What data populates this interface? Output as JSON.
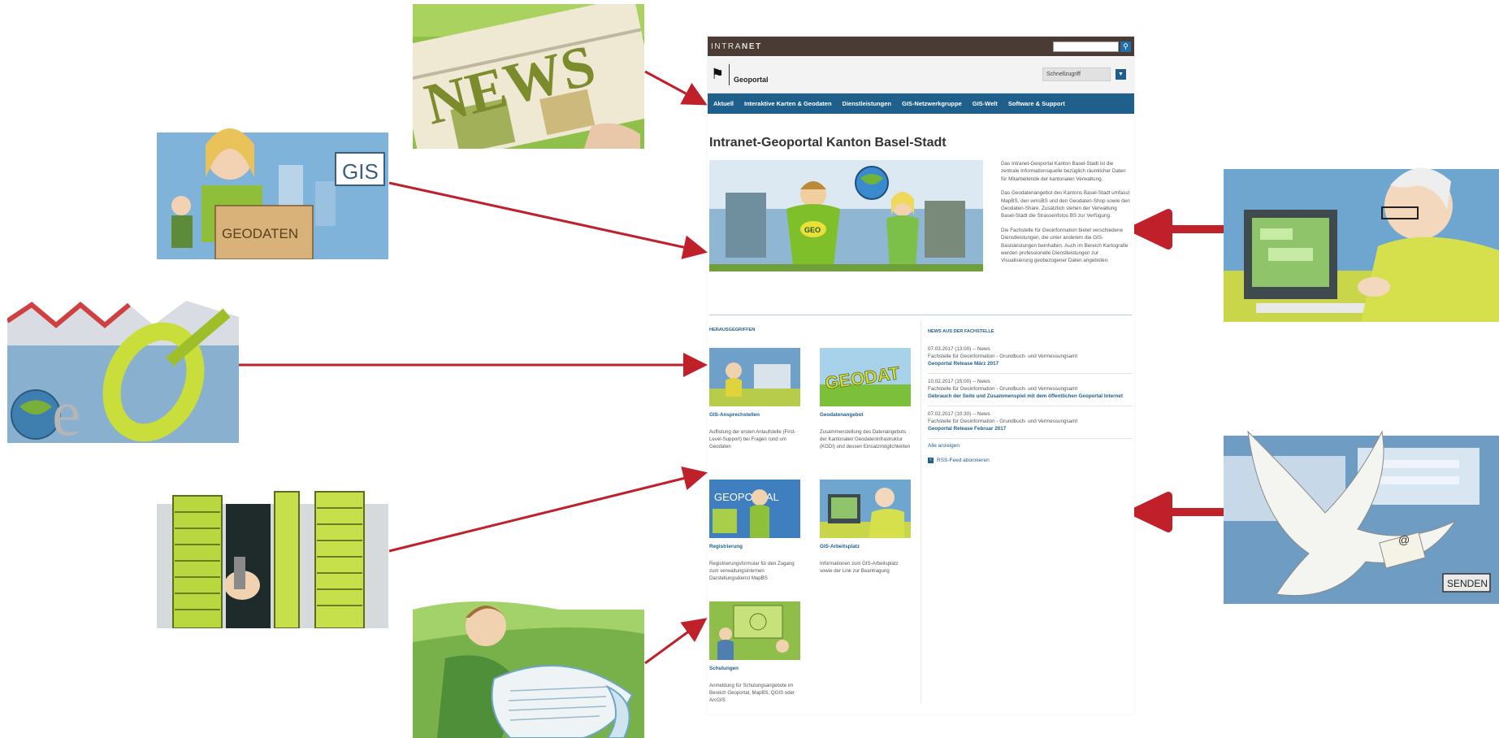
{
  "topbar": {
    "brand_light": "INTRA",
    "brand_bold": "NET",
    "search_placeholder": "",
    "search_icon": "search-icon"
  },
  "header": {
    "site_name": "Geoportal",
    "quick_access": "Schnellzugriff",
    "logo_icon": "basel-staff-icon"
  },
  "nav": [
    "Aktuell",
    "Interaktive Karten & Geodaten",
    "Dienstleistungen",
    "GIS-Netzwerkgruppe",
    "GIS-Welt",
    "Software & Support"
  ],
  "main": {
    "title": "Intranet-Geoportal Kanton Basel-Stadt",
    "intro": [
      "Das Intranet-Geoportal Kanton Basel-Stadt ist die zentrale Informationsquelle bezüglich räumlicher Daten für Mitarbeitende der kantonalen Verwaltung.",
      "Das Geodatenangebot des Kantons Basel-Stadt umfasst MapBS, den wmsBS und den Geodaten-Shop sowie den Geodaten-Share. Zusätzlich stehen der Verwaltung Basel-Stadt die Strassenfotos BS zur Verfügung.",
      "Die Fachstelle für Geoinformation bietet verschiedene Dienstleistungen, die unter anderem die GIS-Basisleistungen beinhalten. Auch im Bereich Kartografie werden professionelle Dienstleistungen zur Visualisierung geobezogener Daten angeboten."
    ]
  },
  "featured": {
    "heading": "HERAUSGEGRIFFEN",
    "cards": [
      {
        "title": "GIS-Ansprechstellen",
        "desc": "Auflistung der ersten Anlaufstelle (First-Level-Support) bei Fragen rund um Geodaten"
      },
      {
        "title": "Geodatenangebot",
        "desc": "Zusammenstellung des Datenangebots der Kantonalen Geodateninfrastruktur (KGDI) und dessen Einsatzmöglichkeiten"
      },
      {
        "title": "Registrierung",
        "desc": "Registrierungsformular für den Zugang zum verwaltungsinternen Darstellungsdienst MapBS"
      },
      {
        "title": "GIS-Arbeitsplatz",
        "desc": "Informationen zum GIS-Arbeitsplatz sowie der Link zur Beantragung"
      },
      {
        "title": "Schulungen",
        "desc": "Anmeldung für Schulungsangebote im Bereich Geoportal, MapBS, QGIS oder ArcGIS"
      }
    ]
  },
  "news": {
    "heading": "NEWS AUS DER FACHSTELLE",
    "items": [
      {
        "meta": "07.03.2017 (13:00) -- News",
        "source": "Fachstelle für Geoinformation - Grundbuch- und Vermessungsamt",
        "title": "Geoportal Release März 2017"
      },
      {
        "meta": "10.02.2017 (15:00) -- News",
        "source": "Fachstelle für Geoinformation - Grundbuch- und Vermessungsamt",
        "title": "Gebrauch der Seite und Zusammenspiel mit dem öffentlichen Geoportal Internet"
      },
      {
        "meta": "07.02.2017 (10:30) -- News",
        "source": "Fachstelle für Geoinformation - Grundbuch- und Vermessungsamt",
        "title": "Geoportal Release Februar 2017"
      }
    ],
    "show_all": "Alle anzeigen",
    "rss": "RSS-Feed abonnieren"
  },
  "illustrations": {
    "news_paper": "NEWS",
    "geodaten_box": "GEODATEN",
    "gis_sign": "GIS",
    "send_button": "SENDEN",
    "hero_badge": "GEO",
    "geodat_sign": "GEODAT",
    "geoportal_sign": "GEOPORTAL"
  },
  "colors": {
    "nav": "#1e5f8c",
    "topbar": "#4a3c35",
    "arrow": "#c0202a"
  }
}
